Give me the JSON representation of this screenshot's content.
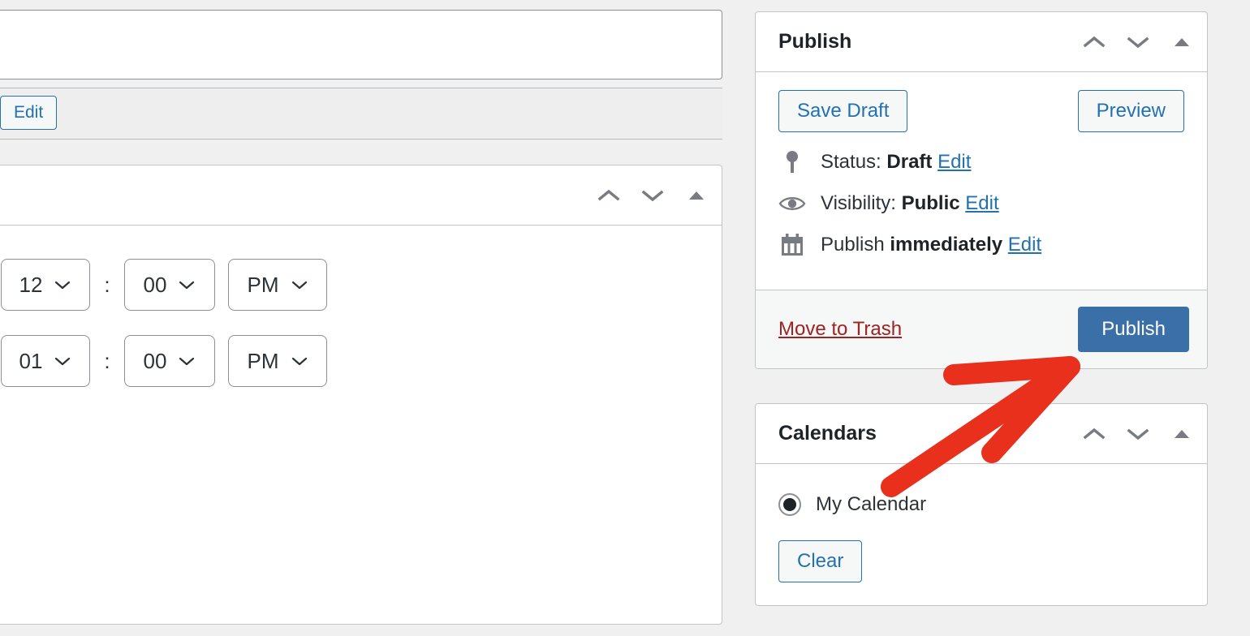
{
  "left": {
    "edit_button": "Edit",
    "panel_icons": [
      "move-up",
      "move-down",
      "toggle"
    ],
    "time_rows": [
      {
        "hour": "12",
        "separator": ":",
        "minute": "00",
        "meridiem": "PM"
      },
      {
        "hour": "01",
        "separator": ":",
        "minute": "00",
        "meridiem": "PM"
      }
    ]
  },
  "sidebar": {
    "publish": {
      "title": "Publish",
      "save_draft_label": "Save Draft",
      "preview_label": "Preview",
      "status": {
        "icon": "pin-icon",
        "label": "Status:",
        "value": "Draft",
        "edit": "Edit"
      },
      "visibility": {
        "icon": "eye-icon",
        "label": "Visibility:",
        "value": "Public",
        "edit": "Edit"
      },
      "schedule": {
        "icon": "calendar-icon",
        "label": "Publish",
        "value": "immediately",
        "edit": "Edit"
      },
      "trash_label": "Move to Trash",
      "publish_label": "Publish"
    },
    "calendars": {
      "title": "Calendars",
      "options": [
        {
          "label": "My Calendar",
          "selected": true
        }
      ],
      "clear_label": "Clear"
    }
  },
  "colors": {
    "primary_button": "#3b6fa8",
    "link": "#2271b1",
    "trash_link": "#a02222",
    "annotation": "#e8301d",
    "page_background": "#f0f0f1",
    "panel_border": "#c3c4c7"
  }
}
